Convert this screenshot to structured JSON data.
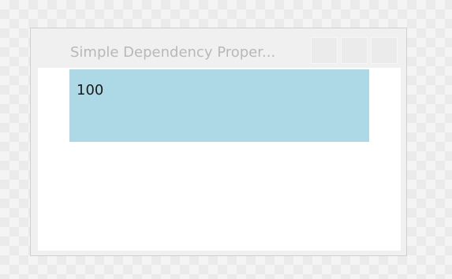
{
  "window": {
    "title": "Simple Dependency Proper..."
  },
  "content": {
    "value": "100",
    "background_color": "#add8e6"
  }
}
